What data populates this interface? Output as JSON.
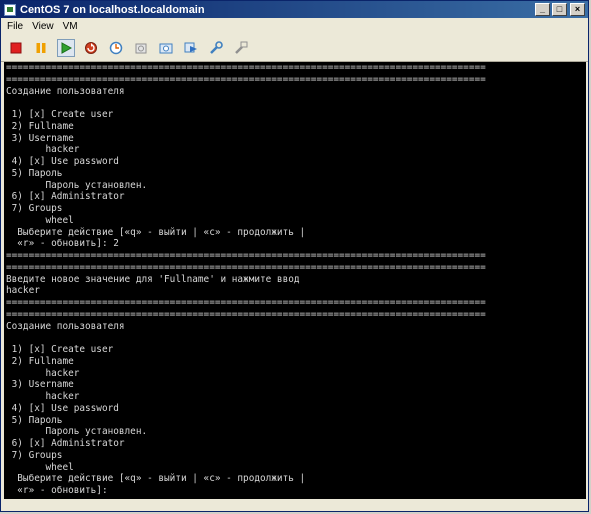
{
  "window": {
    "title": "CentOS 7 on localhost.localdomain",
    "controls": {
      "minimize": "_",
      "maximize": "□",
      "close": "×"
    }
  },
  "menu": [
    {
      "label": "File"
    },
    {
      "label": "View"
    },
    {
      "label": "VM"
    }
  ],
  "toolbar": [
    {
      "name": "stop-icon",
      "color": "#e02020"
    },
    {
      "name": "pause-icon",
      "color": "#f0a000"
    },
    {
      "name": "play-icon",
      "color": "#30a030"
    },
    {
      "name": "reset-icon",
      "color": "#d04020"
    },
    {
      "name": "snapshot-icon",
      "color": "#4080c0"
    },
    {
      "name": "revert-icon",
      "color": "#909090"
    },
    {
      "name": "snapshot-manager-icon",
      "color": "#4080c0"
    },
    {
      "name": "send-keys-icon",
      "color": "#4080c0"
    },
    {
      "name": "settings-icon",
      "color": "#4080c0"
    },
    {
      "name": "tools-icon",
      "color": "#909090"
    }
  ],
  "console": {
    "lines": [
      "=====================================================================================",
      "=====================================================================================",
      "Создание пользователя",
      "",
      " 1) [x] Create user",
      " 2) Fullname",
      " 3) Username",
      "       hacker",
      " 4) [x] Use password",
      " 5) Пароль",
      "       Пароль установлен.",
      " 6) [x] Administrator",
      " 7) Groups",
      "       wheel",
      "  Выберите действие [«q» - выйти | «c» - продолжить |",
      "  «r» - обновить]: 2",
      "=====================================================================================",
      "=====================================================================================",
      "Введите новое значение для 'Fullname' и нажмите ввод",
      "hacker",
      "=====================================================================================",
      "=====================================================================================",
      "Создание пользователя",
      "",
      " 1) [x] Create user",
      " 2) Fullname",
      "       hacker",
      " 3) Username",
      "       hacker",
      " 4) [x] Use password",
      " 5) Пароль",
      "       Пароль установлен.",
      " 6) [x] Administrator",
      " 7) Groups",
      "       wheel",
      "  Выберите действие [«q» - выйти | «c» - продолжить |",
      "  «r» - обновить]:"
    ]
  }
}
